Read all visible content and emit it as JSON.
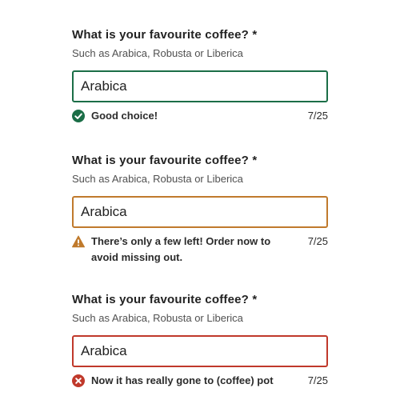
{
  "fields": [
    {
      "label": "What is your favourite coffee? *",
      "hint": "Such as Arabica, Robusta or Liberica",
      "value": "Arabica",
      "state": "success",
      "message": "Good choice!",
      "count": "7/25",
      "icon": "check-circle-icon",
      "color": "#1b6e47"
    },
    {
      "label": "What is your favourite coffee? *",
      "hint": "Such as Arabica, Robusta or Liberica",
      "value": "Arabica",
      "state": "warning",
      "message": "There’s only a few left! Order now to avoid missing out.",
      "count": "7/25",
      "icon": "warning-triangle-icon",
      "color": "#c07a2c"
    },
    {
      "label": "What is your favourite coffee? *",
      "hint": "Such as Arabica, Robusta or Liberica",
      "value": "Arabica",
      "state": "error",
      "message": "Now it has really gone to (coffee) pot",
      "count": "7/25",
      "icon": "error-circle-icon",
      "color": "#c0392b"
    }
  ]
}
